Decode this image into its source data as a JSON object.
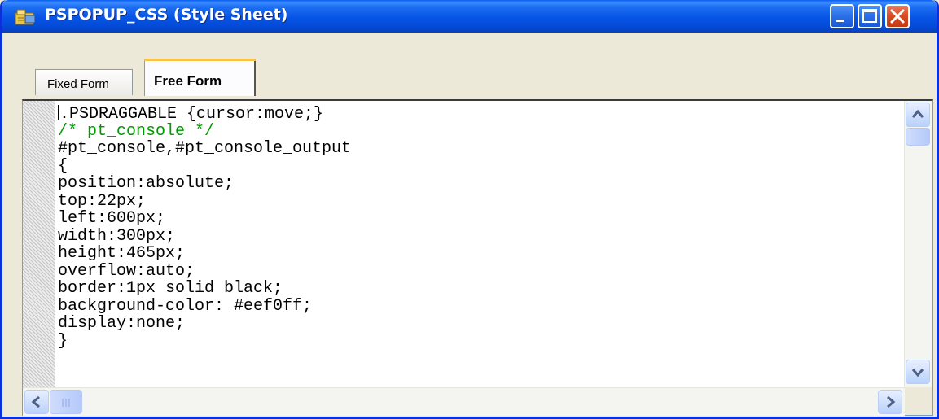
{
  "window": {
    "title": "PSPOPUP_CSS (Style Sheet)",
    "icon": "stylesheet-app-icon",
    "controls": {
      "minimize": "minimize-icon",
      "maximize": "maximize-icon",
      "close": "close-icon"
    }
  },
  "tabs": [
    {
      "label": "Fixed Form",
      "active": false
    },
    {
      "label": "Free Form",
      "active": true
    }
  ],
  "editor": {
    "lines": [
      {
        "text": ".PSDRAGGABLE {cursor:move;}",
        "type": "code"
      },
      {
        "text": "/* pt_console */",
        "type": "comment"
      },
      {
        "text": "#pt_console,#pt_console_output",
        "type": "code"
      },
      {
        "text": "{",
        "type": "code"
      },
      {
        "text": "position:absolute;",
        "type": "code"
      },
      {
        "text": "top:22px;",
        "type": "code"
      },
      {
        "text": "left:600px;",
        "type": "code"
      },
      {
        "text": "width:300px;",
        "type": "code"
      },
      {
        "text": "height:465px;",
        "type": "code"
      },
      {
        "text": "overflow:auto;",
        "type": "code"
      },
      {
        "text": "border:1px solid black;",
        "type": "code"
      },
      {
        "text": "background-color: #eef0ff;",
        "type": "code"
      },
      {
        "text": "display:none;",
        "type": "code"
      },
      {
        "text": "}",
        "type": "code"
      }
    ],
    "comment_color": "#009900"
  },
  "colors": {
    "titlebar": "#0654e6",
    "close_button": "#d84a22",
    "active_tab_highlight": "#f7c24b"
  }
}
